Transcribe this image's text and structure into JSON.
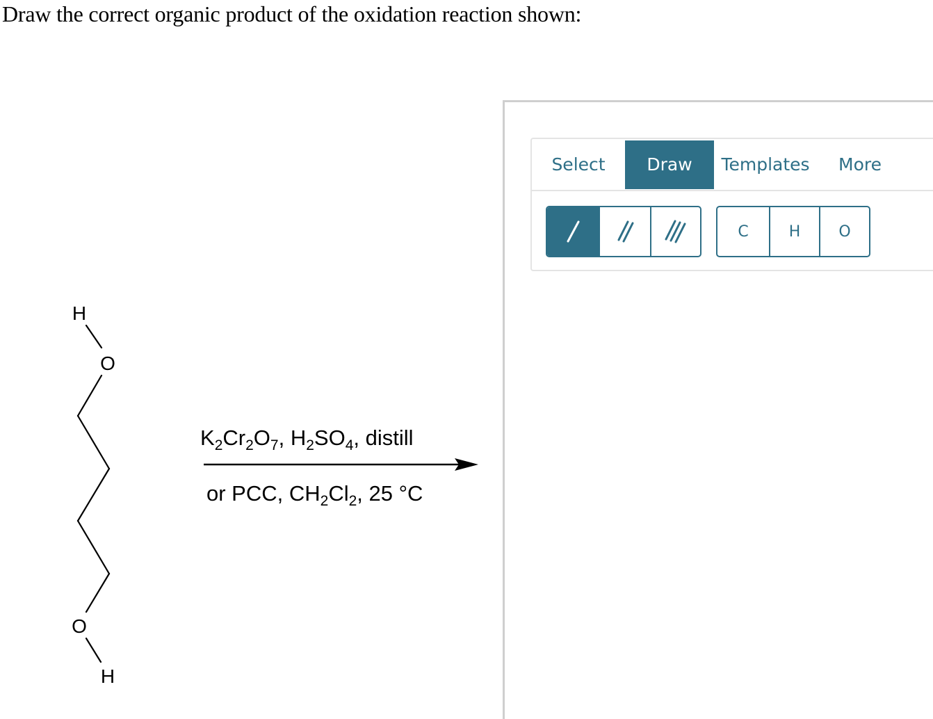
{
  "question": {
    "text": "Draw the correct organic product of the oxidation reaction shown:"
  },
  "molecule": {
    "atoms": [
      "H",
      "O",
      "O",
      "H"
    ]
  },
  "reaction": {
    "reagent_top": "K2Cr2O7, H2SO4, distill",
    "reagent_bottom": "or PCC, CH2Cl2, 25 °C"
  },
  "editor": {
    "tabs": [
      {
        "label": "Select",
        "active": false
      },
      {
        "label": "Draw",
        "active": true
      },
      {
        "label": "Templates",
        "active": false
      },
      {
        "label": "More",
        "active": false
      }
    ],
    "bond_tools": [
      {
        "icon": "single-bond-icon",
        "active": true
      },
      {
        "icon": "double-bond-icon",
        "active": false
      },
      {
        "icon": "triple-bond-icon",
        "active": false
      }
    ],
    "atom_tools": [
      "C",
      "H",
      "O"
    ],
    "accent_color": "#2e6f87"
  }
}
